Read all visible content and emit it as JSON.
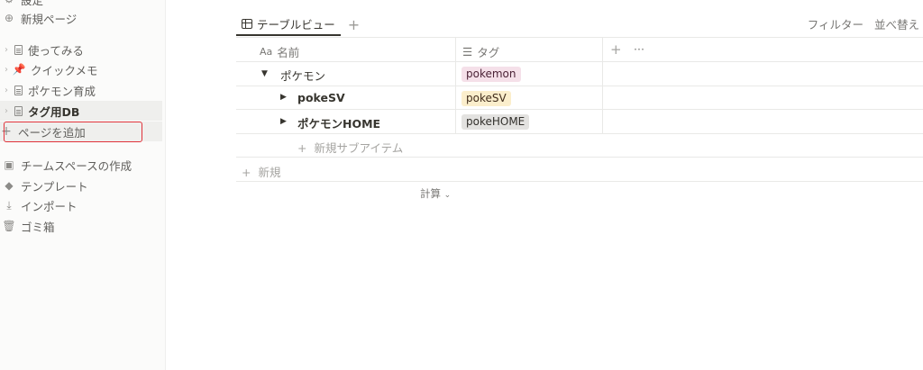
{
  "sidebar": {
    "top_items": [
      {
        "label": "設定",
        "icon": "gear-icon"
      },
      {
        "label": "新規ページ",
        "icon": "plus-circle-icon"
      }
    ],
    "pages": [
      {
        "label": "使ってみる",
        "icon": "document-icon"
      },
      {
        "label": "クイックメモ",
        "icon": "pushpin-icon"
      },
      {
        "label": "ポケモン育成",
        "icon": "document-icon"
      },
      {
        "label": "タグ用DB",
        "icon": "document-icon"
      }
    ],
    "add_page_label": "ページを追加",
    "bottom_items": [
      {
        "label": "チームスペースの作成",
        "icon": "team-icon"
      },
      {
        "label": "テンプレート",
        "icon": "template-shapes-icon"
      },
      {
        "label": "インポート",
        "icon": "download-icon"
      },
      {
        "label": "ゴミ箱",
        "icon": "trash-icon"
      }
    ],
    "highlight_color": "#e0323a"
  },
  "main": {
    "tab_label": "テーブルビュー",
    "filter_label": "フィルター",
    "sort_label": "並べ替え",
    "columns": {
      "name_prefix": "Aa",
      "name": "名前",
      "tag": "タグ",
      "add": "+",
      "more": "···"
    },
    "rows": [
      {
        "name": "ポケモン",
        "tag": "pokemon",
        "tag_color": "#f5e0e9",
        "expanded": true
      },
      {
        "name": "pokeSV",
        "tag": "pokeSV",
        "tag_color": "#fbeecc",
        "expanded": false
      },
      {
        "name": "ポケモンHOME",
        "tag": "pokeHOME",
        "tag_color": "#e3e2e0",
        "expanded": false
      }
    ],
    "new_sub_item": "新規サブアイテム",
    "new_label": "新規",
    "calc_label": "計算"
  }
}
